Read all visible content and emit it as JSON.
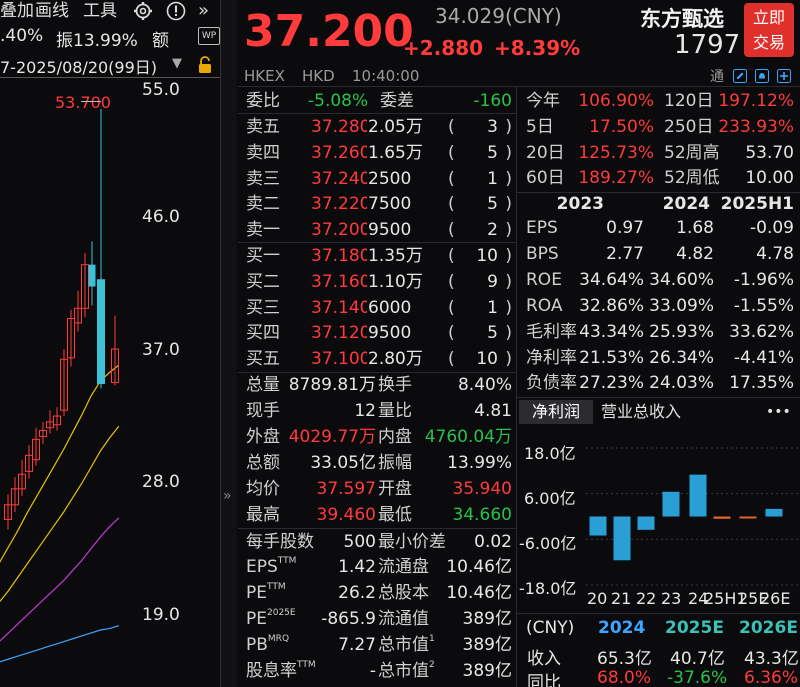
{
  "toolbar": {
    "item1": "叠加",
    "item2": "画线",
    "item3": "工具",
    "amp_partial": ".40%",
    "amplitude": "振13.99%",
    "extra": "额",
    "date_range": "7-2025/08/20(99日)"
  },
  "chart": {
    "high_marker": "53.700",
    "yticks": [
      "55.0",
      "46.0",
      "37.0",
      "28.0",
      "19.0"
    ],
    "expand": "»",
    "candles": [
      {
        "o": 25.5,
        "c": 26.5,
        "h": 27.2,
        "l": 24.8
      },
      {
        "o": 26.5,
        "c": 27.6,
        "h": 28.4,
        "l": 26.0
      },
      {
        "o": 27.6,
        "c": 28.6,
        "h": 29.6,
        "l": 27.1
      },
      {
        "o": 28.8,
        "c": 29.9,
        "h": 30.6,
        "l": 28.3
      },
      {
        "o": 29.6,
        "c": 31.0,
        "h": 31.8,
        "l": 29.2
      },
      {
        "o": 31.2,
        "c": 31.6,
        "h": 32.2,
        "l": 30.7
      },
      {
        "o": 31.8,
        "c": 32.2,
        "h": 33.0,
        "l": 31.4
      },
      {
        "o": 32.0,
        "c": 32.6,
        "h": 33.2,
        "l": 31.6
      },
      {
        "o": 33.0,
        "c": 36.5,
        "h": 37.2,
        "l": 32.6
      },
      {
        "o": 36.6,
        "c": 39.3,
        "h": 39.9,
        "l": 36.0
      },
      {
        "o": 39.0,
        "c": 40.0,
        "h": 41.2,
        "l": 38.4
      },
      {
        "o": 40.0,
        "c": 43.0,
        "h": 43.8,
        "l": 39.4
      },
      {
        "o": 43.0,
        "c": 41.5,
        "h": 44.6,
        "l": 40.2
      },
      {
        "o": 42.0,
        "c": 34.8,
        "h": 53.7,
        "l": 34.5
      },
      {
        "o": 34.9,
        "c": 37.2,
        "h": 39.5,
        "l": 34.7
      }
    ],
    "ma": [
      [
        21.5,
        22.5,
        23.6,
        24.7,
        25.9,
        27.0,
        28.1,
        29.2,
        30.3,
        31.5,
        32.7,
        34.0,
        35.0,
        35.6,
        36.1
      ],
      [
        19.0,
        19.8,
        20.6,
        21.5,
        22.4,
        23.3,
        24.2,
        25.1,
        26.0,
        27.0,
        28.0,
        29.1,
        30.2,
        31.1,
        31.9
      ],
      [
        16.6,
        17.1,
        17.7,
        18.3,
        18.9,
        19.5,
        20.1,
        20.7,
        21.3,
        22.0,
        22.7,
        23.5,
        24.3,
        25.0,
        25.6
      ],
      [
        15.5,
        15.7,
        15.9,
        16.1,
        16.3,
        16.5,
        16.7,
        16.9,
        17.1,
        17.3,
        17.5,
        17.7,
        17.9,
        18.0,
        18.2
      ]
    ]
  },
  "quote": {
    "price": "37.200",
    "ref_price": "34.029(CNY)",
    "change": "+2.880",
    "change_pct": "+8.39%",
    "exchange": "HKEX",
    "currency": "HKD",
    "time": "10:40:00",
    "name": "东方甄选",
    "code": "1797",
    "buy_btn_l1": "立即",
    "buy_btn_l2": "交易",
    "tong": "通"
  },
  "orderbook": {
    "weibi_label": "委比",
    "weibi": "-5.08%",
    "weicha_label": "委差",
    "weicha": "-160",
    "asks": [
      {
        "label": "卖五",
        "price": "37.280",
        "vol": "2.05万",
        "count": "3"
      },
      {
        "label": "卖四",
        "price": "37.260",
        "vol": "1.65万",
        "count": "5"
      },
      {
        "label": "卖三",
        "price": "37.240",
        "vol": "2500",
        "count": "1"
      },
      {
        "label": "卖二",
        "price": "37.220",
        "vol": "7500",
        "count": "5"
      },
      {
        "label": "卖一",
        "price": "37.200",
        "vol": "9500",
        "count": "2"
      }
    ],
    "bids": [
      {
        "label": "买一",
        "price": "37.180",
        "vol": "1.35万",
        "count": "10"
      },
      {
        "label": "买二",
        "price": "37.160",
        "vol": "1.10万",
        "count": "9"
      },
      {
        "label": "买三",
        "price": "37.140",
        "vol": "6000",
        "count": "1"
      },
      {
        "label": "买四",
        "price": "37.120",
        "vol": "9500",
        "count": "5"
      },
      {
        "label": "买五",
        "price": "37.100",
        "vol": "2.80万",
        "count": "10"
      }
    ]
  },
  "stats": {
    "zongliang_l": "总量",
    "zongliang": "8789.81万",
    "huanshou_l": "换手",
    "huanshou": "8.40%",
    "xianshou_l": "现手",
    "xianshou": "12",
    "liangbi_l": "量比",
    "liangbi": "4.81",
    "waipan_l": "外盘",
    "waipan": "4029.77万",
    "neipan_l": "内盘",
    "neipan": "4760.04万",
    "zonge_l": "总额",
    "zonge": "33.05亿",
    "zhenfu_l": "振幅",
    "zhenfu": "13.99%",
    "junjia_l": "均价",
    "junjia": "37.597",
    "kaipan_l": "开盘",
    "kaipan": "35.940",
    "zuigao_l": "最高",
    "zuigao": "39.460",
    "zuidi_l": "最低",
    "zuidi": "34.660",
    "meishou_l": "每手股数",
    "meishou": "500",
    "zuixiao_l": "最小价差",
    "zuixiao": "0.02",
    "eps_l": "EPS",
    "eps_sup": "TTM",
    "eps": "1.42",
    "liutongpan_l": "流通盘",
    "liutongpan": "10.46亿",
    "pe_l": "PE",
    "pe_sup": "TTM",
    "pe": "26.2",
    "zongguben_l": "总股本",
    "zongguben": "10.46亿",
    "pe2_l": "PE",
    "pe2_sup": "2025E",
    "pe2": "-865.9",
    "liutongzhi_l": "流通值",
    "liutongzhi": "389亿",
    "pb_l": "PB",
    "pb_sup": "MRQ",
    "pb": "7.27",
    "zongshizhi1_l": "总市值",
    "zongshizhi1_sup": "1",
    "zongshizhi1": "389亿",
    "guxi_l": "股息率",
    "guxi_sup": "TTM",
    "guxi": "-",
    "zongshizhi2_l": "总市值",
    "zongshizhi2_sup": "2",
    "zongshizhi2": "389亿"
  },
  "perf": {
    "ytd_l": "今年",
    "ytd": "106.90%",
    "d120_l": "120日",
    "d120": "197.12%",
    "d5_l": "5日",
    "d5": "17.50%",
    "d250_l": "250日",
    "d250": "233.93%",
    "d20_l": "20日",
    "d20": "125.73%",
    "wh_l": "52周高",
    "wh": "53.70",
    "d60_l": "60日",
    "d60": "189.27%",
    "wl_l": "52周低",
    "wl": "10.00"
  },
  "fin": {
    "headers": [
      "2023",
      "2024",
      "2025H1"
    ],
    "rows": [
      {
        "label": "EPS",
        "v": [
          "0.97",
          "1.68",
          "-0.09"
        ]
      },
      {
        "label": "BPS",
        "v": [
          "2.77",
          "4.82",
          "4.78"
        ]
      },
      {
        "label": "ROE",
        "v": [
          "34.64%",
          "34.60%",
          "-1.96%"
        ]
      },
      {
        "label": "ROA",
        "v": [
          "32.86%",
          "33.09%",
          "-1.55%"
        ]
      },
      {
        "label": "毛利率",
        "v": [
          "43.34%",
          "25.93%",
          "33.62%"
        ]
      },
      {
        "label": "净利率",
        "v": [
          "21.53%",
          "26.34%",
          "-4.41%"
        ]
      },
      {
        "label": "负债率",
        "v": [
          "27.23%",
          "24.03%",
          "17.35%"
        ]
      }
    ]
  },
  "profit_tabs": {
    "tab1": "净利润",
    "tab2": "营业总收入",
    "more": "•••"
  },
  "chart_data": {
    "type": "bar",
    "categories": [
      "20",
      "21",
      "22",
      "23",
      "24",
      "25H1",
      "25E",
      "26E"
    ],
    "values": [
      -5.0,
      -11.5,
      -3.5,
      6.5,
      11.0,
      -0.6,
      -0.3,
      2.0
    ],
    "yticks": [
      "18.0亿",
      "6.00亿",
      "-6.00亿",
      "-18.0亿"
    ],
    "ylim": [
      -18,
      18
    ]
  },
  "forecast": {
    "unit": "(CNY)",
    "y1": "2024",
    "y2": "2025E",
    "y3": "2026E",
    "rev_l": "收入",
    "rev1": "65.3亿",
    "rev2": "40.7亿",
    "rev3": "43.3亿",
    "yoy_l": "同比",
    "yoy1": "68.0%",
    "yoy2": "-37.6%",
    "yoy3": "6.36%"
  },
  "colors": {
    "up": "#ff3b3b",
    "down": "#27c24c",
    "bar": "#2a9fd6",
    "accent": "#e0302b"
  }
}
